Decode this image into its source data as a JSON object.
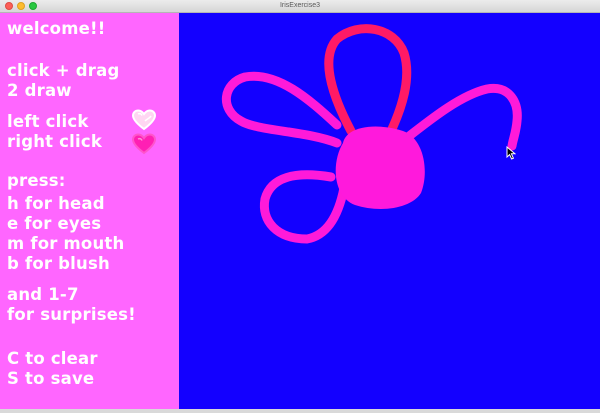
{
  "window": {
    "title": "IrisExercise3"
  },
  "sidebar": {
    "background": "#ff66ff",
    "lines": [
      "welcome!!",
      "click + drag",
      "2 draw",
      "left click",
      "right click",
      "press:",
      "h for head",
      "e for eyes",
      "m for mouth",
      "b for blush",
      "and 1-7",
      "for surprises!",
      "C to clear",
      "S to save"
    ],
    "icons": {
      "left_click": "white-heart-icon",
      "right_click": "pink-heart-icon"
    }
  },
  "canvas": {
    "background": "#1300ff",
    "drawing": "pink-flower-drawing",
    "colors": {
      "petals": "#ff1ad9",
      "top_petal": "#ff1a66",
      "center": "#ff19dc"
    }
  }
}
